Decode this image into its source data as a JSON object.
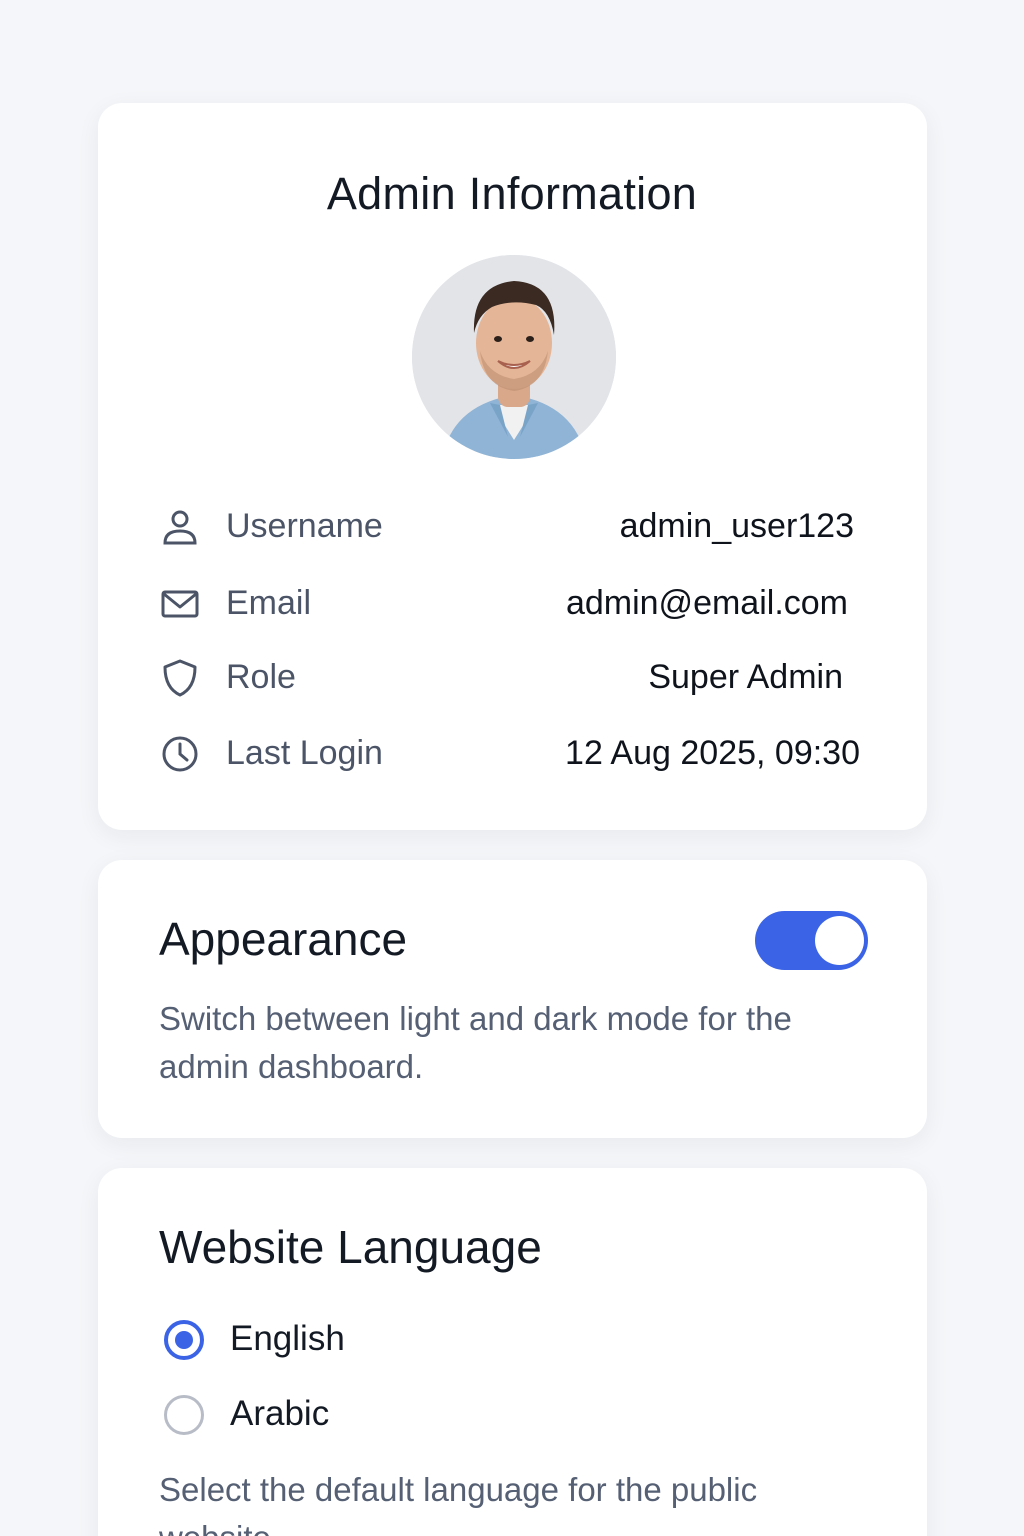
{
  "admin_card": {
    "title": "Admin Information",
    "rows": [
      {
        "icon": "user-icon",
        "label": "Username",
        "value": "admin_user123"
      },
      {
        "icon": "mail-icon",
        "label": "Email",
        "value": "admin@email.com"
      },
      {
        "icon": "shield-icon",
        "label": "Role",
        "value": "Super Admin"
      },
      {
        "icon": "clock-icon",
        "label": "Last Login",
        "value": "12 Aug 2025, 09:30"
      }
    ]
  },
  "appearance": {
    "title": "Appearance",
    "description": "Switch between light and dark mode for the admin dashboard.",
    "toggle_on": true
  },
  "language": {
    "title": "Website Language",
    "options": [
      {
        "label": "English",
        "selected": true
      },
      {
        "label": "Arabic",
        "selected": false
      }
    ],
    "description": "Select the default language for the public website."
  },
  "colors": {
    "accent": "#3b63e6",
    "background": "#f4f6f9",
    "card": "#ffffff",
    "text_primary": "#141a24",
    "text_secondary": "#4b5567"
  }
}
